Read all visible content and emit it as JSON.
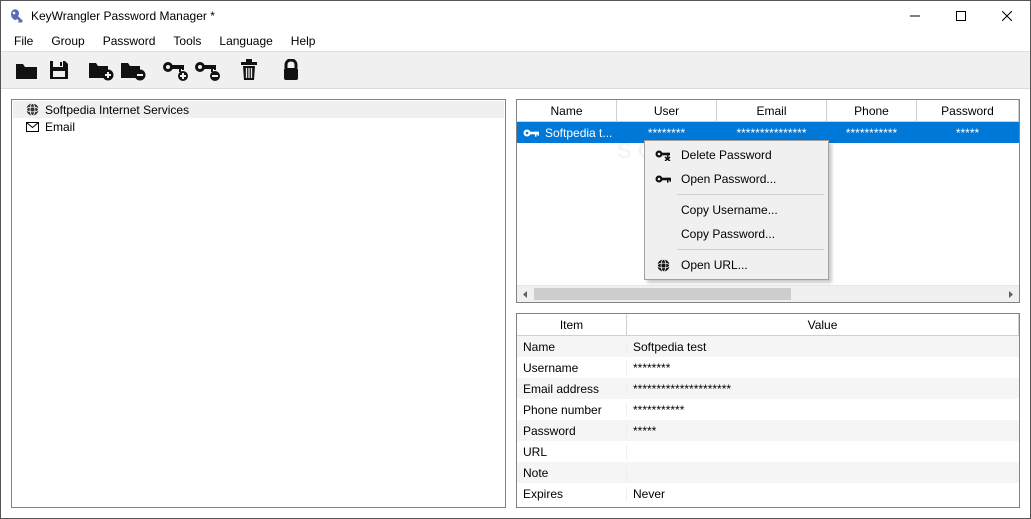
{
  "window": {
    "title": "KeyWrangler Password Manager *"
  },
  "menubar": [
    "File",
    "Group",
    "Password",
    "Tools",
    "Language",
    "Help"
  ],
  "tree": {
    "items": [
      {
        "label": "Softpedia Internet Services",
        "selected": true,
        "icon": "globe"
      },
      {
        "label": "Email",
        "selected": false,
        "icon": "envelope"
      }
    ]
  },
  "list": {
    "columns": [
      "Name",
      "User",
      "Email",
      "Phone",
      "Password"
    ],
    "rows": [
      {
        "name": "Softpedia t...",
        "user": "********",
        "email": "***************",
        "phone": "***********",
        "password": "*****"
      }
    ]
  },
  "context_menu": {
    "items": [
      {
        "label": "Delete Password",
        "icon": "key-x"
      },
      {
        "label": "Open Password...",
        "icon": "key"
      },
      {
        "sep": true
      },
      {
        "label": "Copy Username...",
        "icon": ""
      },
      {
        "label": "Copy Password...",
        "icon": ""
      },
      {
        "sep": true
      },
      {
        "label": "Open URL...",
        "icon": "globe"
      }
    ]
  },
  "details": {
    "headers": [
      "Item",
      "Value"
    ],
    "rows": [
      {
        "item": "Name",
        "value": "Softpedia test"
      },
      {
        "item": "Username",
        "value": "********"
      },
      {
        "item": "Email address",
        "value": "*********************"
      },
      {
        "item": "Phone number",
        "value": "***********"
      },
      {
        "item": "Password",
        "value": "*****"
      },
      {
        "item": "URL",
        "value": ""
      },
      {
        "item": "Note",
        "value": ""
      },
      {
        "item": "Expires",
        "value": "Never"
      }
    ]
  }
}
